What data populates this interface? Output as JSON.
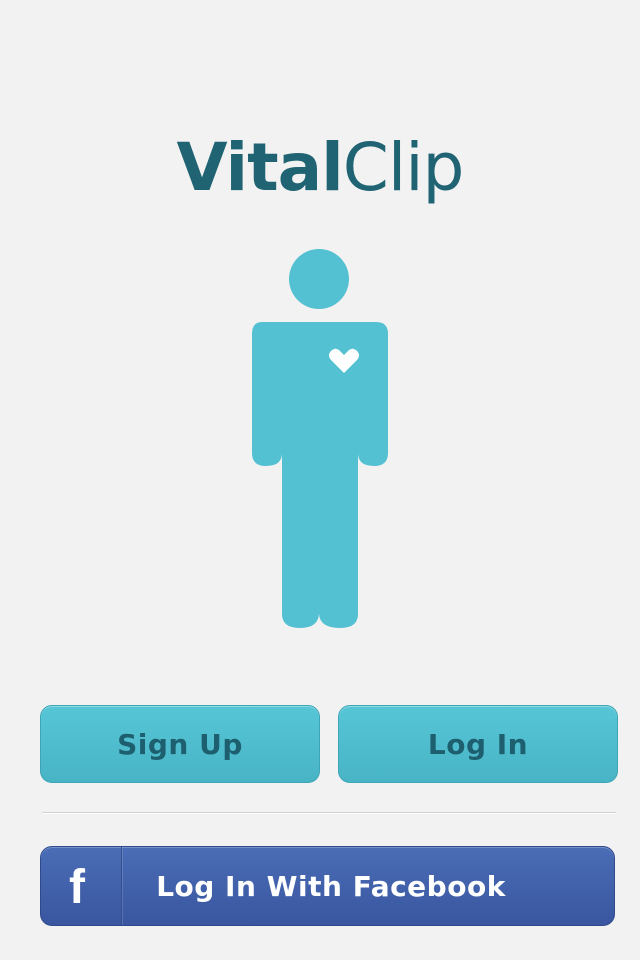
{
  "app": {
    "logo_bold": "Vital",
    "logo_regular": "Clip"
  },
  "colors": {
    "background": "#f2f2f2",
    "brand_dark_teal": "#206373",
    "figure_teal": "#54c1d2",
    "button_teal": "#52c0d1",
    "button_text": "#1d5f6e",
    "facebook_blue": "#4263aa"
  },
  "illustration": {
    "figure_icon": "person-icon",
    "chest_icon": "heart-icon"
  },
  "actions": {
    "sign_up_label": "Sign Up",
    "log_in_label": "Log In",
    "facebook_label": "Log In With Facebook",
    "facebook_icon": "facebook-icon",
    "facebook_glyph": "f"
  }
}
